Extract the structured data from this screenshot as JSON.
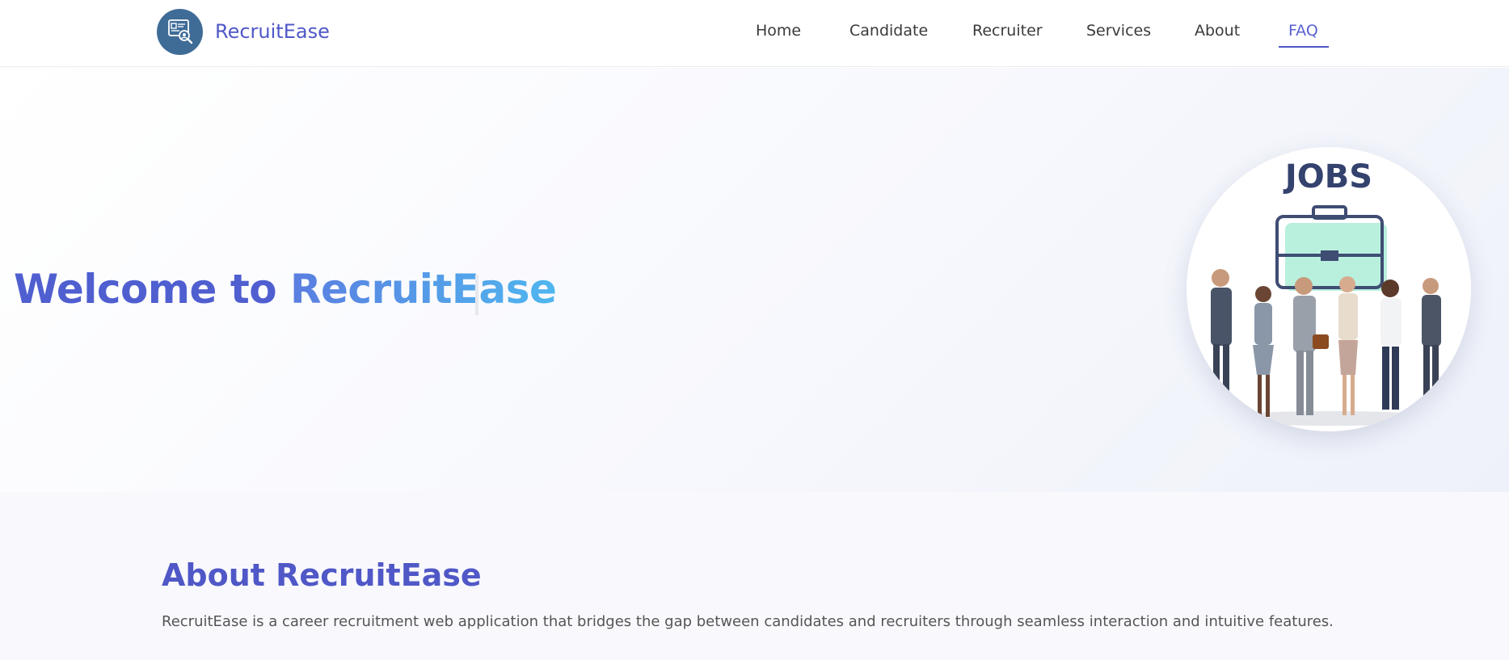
{
  "brand": {
    "name": "RecruitEase",
    "logo_icon": "recruitment-search-icon",
    "color": "#5058c7"
  },
  "nav": {
    "items": [
      {
        "label": "Home"
      },
      {
        "label": "Candidate"
      },
      {
        "label": "Recruiter"
      },
      {
        "label": "Services"
      },
      {
        "label": "About"
      },
      {
        "label": "FAQ",
        "active": true
      }
    ]
  },
  "hero": {
    "title_part1": "Welcome to ",
    "title_part2": "RecruitEase",
    "image_text": "JOBS",
    "image_icon": "briefcase-icon"
  },
  "about": {
    "title": "About RecruitEase",
    "text": "RecruitEase is a career recruitment web application that bridges the gap between candidates and recruiters through seamless interaction and intuitive features."
  },
  "colors": {
    "accent": "#5058c7",
    "gradient_end": "#4fb6ef"
  }
}
